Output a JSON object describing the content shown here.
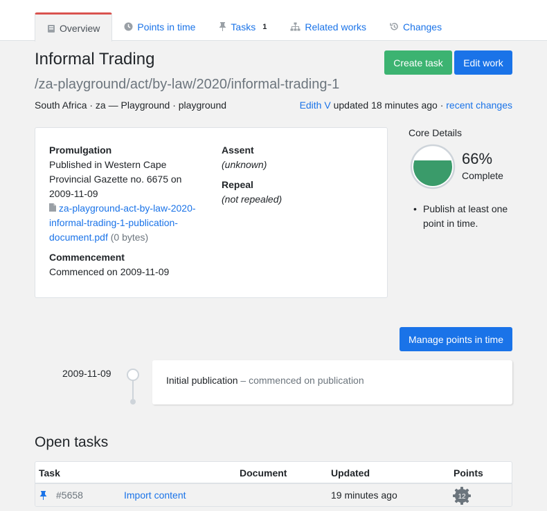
{
  "tabs": [
    {
      "label": "Overview",
      "icon": "book-icon"
    },
    {
      "label": "Points in time",
      "icon": "clock-icon"
    },
    {
      "label": "Tasks",
      "icon": "pin-icon",
      "badge": "1"
    },
    {
      "label": "Related works",
      "icon": "sitemap-icon"
    },
    {
      "label": "Changes",
      "icon": "history-icon"
    }
  ],
  "work": {
    "title": "Informal Trading",
    "frbr_uri": "/za-playground/act/by-law/2020/informal-trading-1",
    "meta": "South Africa · za — Playground · playground",
    "updated_by": "Edith V",
    "updated_text": " updated 18 minutes ago · ",
    "recent_changes": "recent changes"
  },
  "buttons": {
    "create_task": "Create task",
    "edit_work": "Edit work",
    "manage_points": "Manage points in time"
  },
  "details": {
    "promulgation_label": "Promulgation",
    "promulgation_text": "Published in Western Cape Provincial Gazette no. 6675 on 2009-11-09",
    "publication_file": "za-playground-act-by-law-2020-informal-trading-1-publication-document.pdf",
    "publication_size": " (0 bytes)",
    "commencement_label": "Commencement",
    "commencement_text": "Commenced on 2009-11-09",
    "assent_label": "Assent",
    "assent_text": "(unknown)",
    "repeal_label": "Repeal",
    "repeal_text": "(not repealed)"
  },
  "core": {
    "title": "Core Details",
    "percent": "66%",
    "percent_value": 0.66,
    "complete_label": "Complete",
    "todo": [
      "Publish at least one point in time."
    ],
    "accent": "#3a9b6a"
  },
  "timeline": {
    "date": "2009-11-09",
    "event": "Initial publication",
    "detail": " – commenced on publication"
  },
  "open_tasks": {
    "title": "Open tasks",
    "headers": [
      "Task",
      "Document",
      "Updated",
      "Points"
    ],
    "rows": [
      {
        "id": "#5658",
        "title": "Import content",
        "document": "",
        "updated": "19 minutes ago",
        "points": "12"
      }
    ]
  }
}
